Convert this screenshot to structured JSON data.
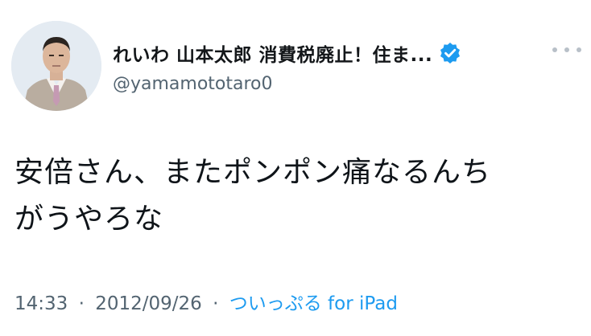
{
  "tweet": {
    "display_name": "れいわ 山本太郎 消費税廃止！住ま...",
    "handle": "@yamamototaro0",
    "text_line1": "安倍さん、またポンポン痛なるんち",
    "text_line2": "がうやろな",
    "time": "14:33",
    "separator": "·",
    "date": "2012/09/26",
    "source": "ついっぷる for iPad",
    "verified": true,
    "icons": [
      "avatar-photo",
      "verified-badge-icon",
      "more-options-icon"
    ]
  },
  "colors": {
    "verified_blue": "#1d9bf0",
    "source_link": "#1d9bf0",
    "secondary_text": "#536471",
    "primary_text": "#0f1419"
  }
}
